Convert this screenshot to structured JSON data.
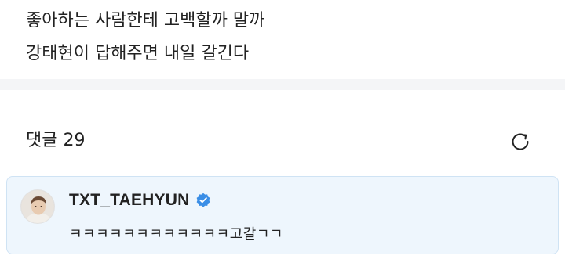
{
  "post": {
    "line1": "좋아하는 사람한테 고백할까 말까",
    "line2": "강태현이 답해주면 내일 갈긴다"
  },
  "comments": {
    "count_label": "댓글 29",
    "refresh_icon": "refresh-icon"
  },
  "pinned_comment": {
    "author": "TXT_TAEHYUN",
    "verified_icon": "verified-badge-icon",
    "text": "ㅋㅋㅋㅋㅋㅋㅋㅋㅋㅋㅋㅋ고갈ㄱㄱ"
  },
  "colors": {
    "accent_blue": "#3a8ee6",
    "card_background": "#eef6fd",
    "divider": "#f4f5f7"
  }
}
